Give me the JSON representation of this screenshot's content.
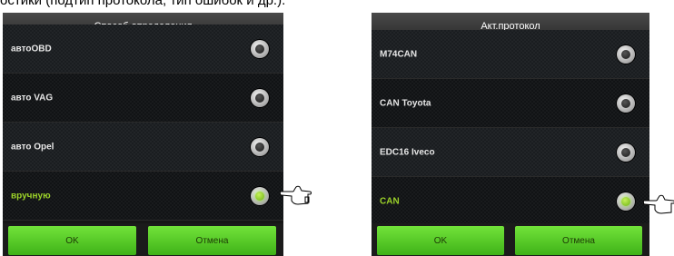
{
  "top_text": "остики (подтип протокола, тип ошибок и др.).",
  "dialog1": {
    "title": "Способ определения",
    "options": [
      {
        "label": "автоOBD",
        "selected": false
      },
      {
        "label": "авто VAG",
        "selected": false
      },
      {
        "label": "авто Opel",
        "selected": false
      },
      {
        "label": "вручную",
        "selected": true
      }
    ],
    "ok_label": "OK",
    "cancel_label": "Отмена"
  },
  "dialog2": {
    "title": "Акт.протокол",
    "options": [
      {
        "label": "M74CAN",
        "selected": false
      },
      {
        "label": "CAN Toyota",
        "selected": false
      },
      {
        "label": "EDC16 Iveco",
        "selected": false
      },
      {
        "label": "CAN",
        "selected": true
      }
    ],
    "ok_label": "OK",
    "cancel_label": "Отмена"
  },
  "colors": {
    "accent": "#5ccb2a",
    "selected_text": "#9cd229",
    "dialog_bg": "#161616"
  },
  "icons": {
    "pointer": "pointing-hand-icon",
    "radio": "radio-button-icon"
  }
}
